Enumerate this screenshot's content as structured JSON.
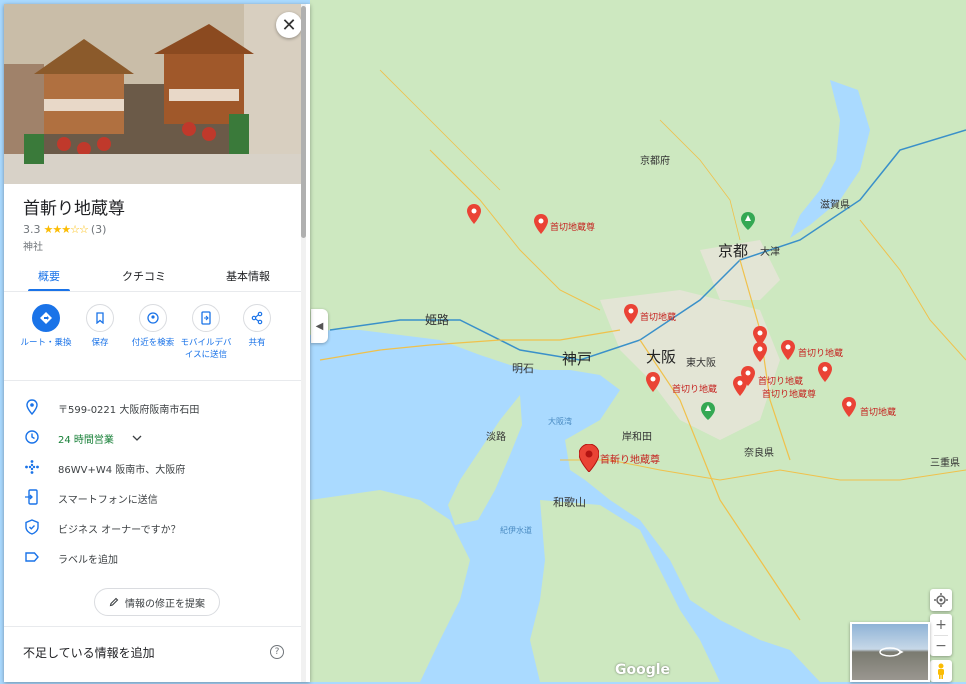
{
  "place": {
    "name": "首斬り地蔵尊",
    "rating": "3.3",
    "review_count": "(3)",
    "stars": "★★★☆☆",
    "category": "神社",
    "close_symbol": "✕"
  },
  "tabs": [
    {
      "label": "概要"
    },
    {
      "label": "クチコミ"
    },
    {
      "label": "基本情報"
    }
  ],
  "actions": [
    {
      "label": "ルート・乗換"
    },
    {
      "label": "保存"
    },
    {
      "label": "付近を検索"
    },
    {
      "label": "モバイルデバイスに送信"
    },
    {
      "label": "共有"
    }
  ],
  "info": {
    "address": "〒599-0221 大阪府阪南市石田",
    "hours": "24 時間営業",
    "plus_code": "86WV+W4 阪南市、大阪府",
    "send_to_phone": "スマートフォンに送信",
    "business_owner": "ビジネス オーナーですか？",
    "add_label": "ラベルを追加"
  },
  "suggest_edit": "情報の修正を提案",
  "missing_info": "不足している情報を追加",
  "help_symbol": "?",
  "map": {
    "google_logo": "Google",
    "selected_pin_label": "首斬り地蔵尊",
    "pin_labels": [
      "首切地蔵尊",
      "首切地蔵",
      "首切り地蔵",
      "首切り地蔵",
      "首切り地蔵",
      "首切り地蔵尊",
      "首切地蔵",
      "首切地蔵尊"
    ],
    "places": [
      "京都",
      "大阪",
      "神戸",
      "姫路",
      "明石",
      "和歌山",
      "大津",
      "奈良県",
      "東大阪",
      "京都府",
      "滋賀県",
      "三重県",
      "淡路",
      "岸和田"
    ],
    "water_labels": [
      "大阪湾",
      "紀伊水道"
    ],
    "zoom_in": "+",
    "zoom_out": "−"
  },
  "colors": {
    "accent": "#1a73e8",
    "pin_red": "#ea4335",
    "land": "#cde8c0",
    "water": "#aadaff",
    "open_green": "#188038"
  },
  "icons": [
    "close-icon",
    "directions-icon",
    "bookmark-icon",
    "nearby-icon",
    "send-to-device-icon",
    "share-icon",
    "location-pin-icon",
    "clock-icon",
    "plus-code-icon",
    "phone-send-icon",
    "shield-check-icon",
    "label-icon",
    "pencil-icon",
    "help-icon",
    "my-location-icon",
    "pegman-icon"
  ]
}
